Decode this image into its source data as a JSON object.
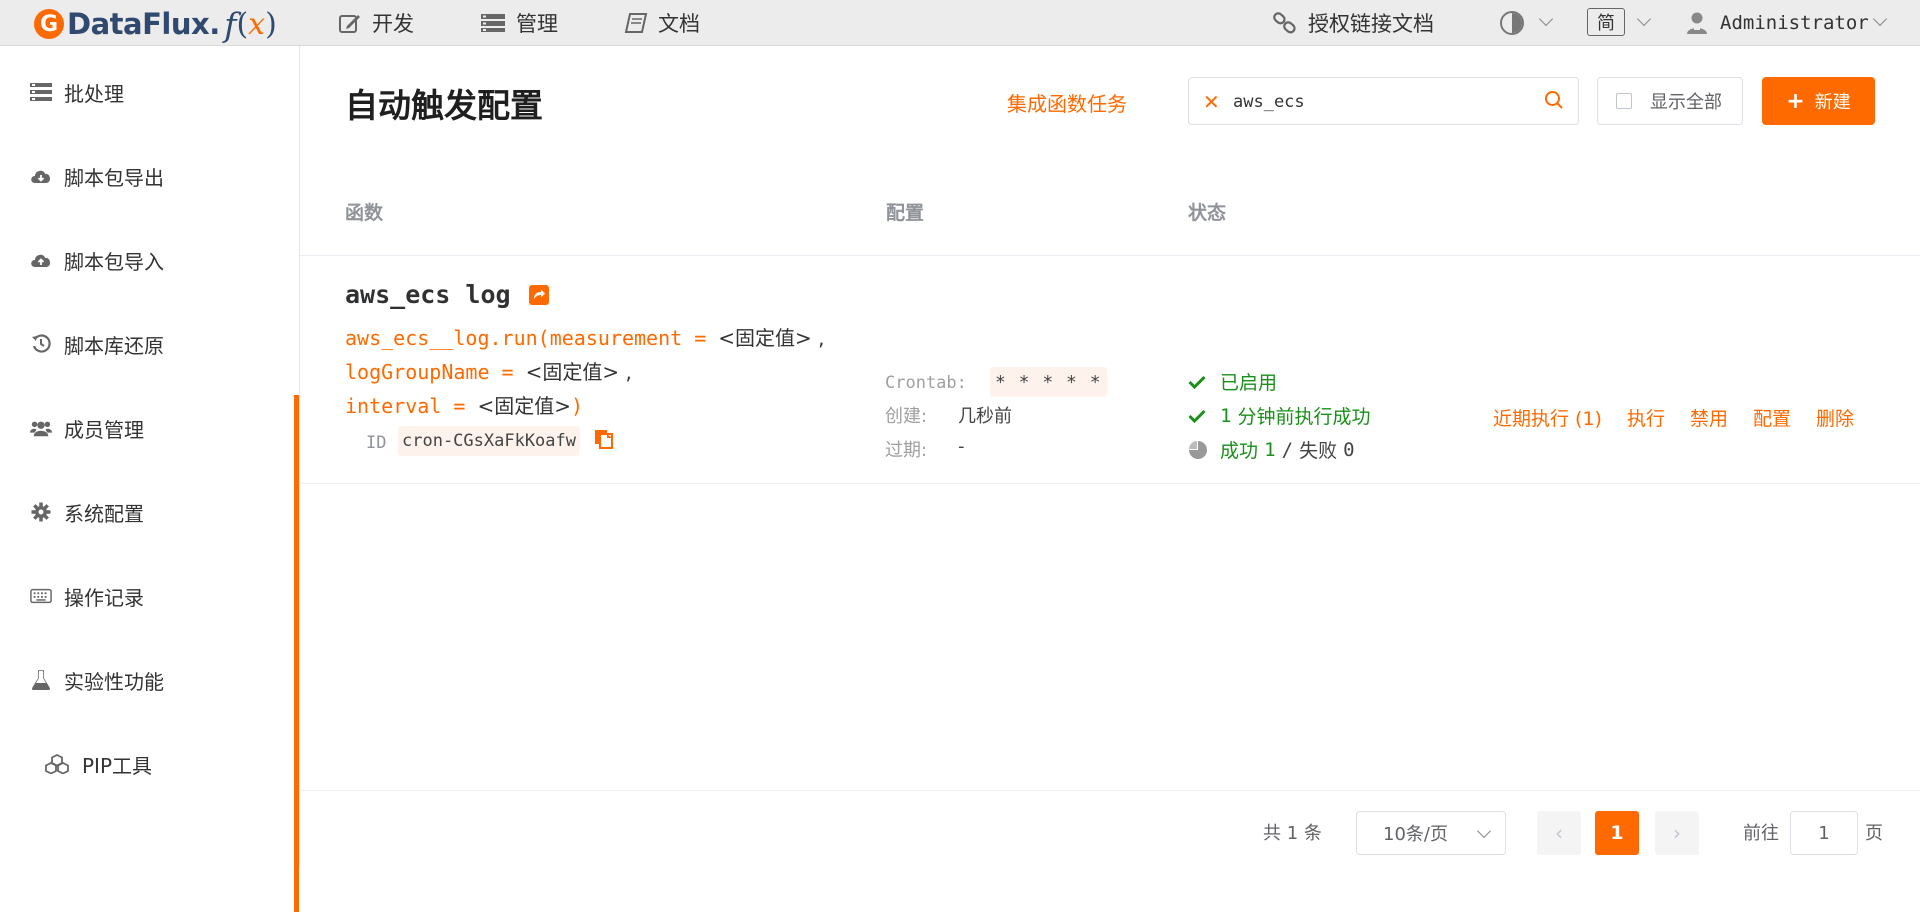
{
  "brand": {
    "name": "DataFlux",
    "dot": ".",
    "f": "f",
    "paren_open": "(",
    "x": "x",
    "paren_close": ")"
  },
  "topnav": {
    "dev": "开发",
    "manage": "管理",
    "docs": "文档",
    "auth_link_docs": "授权链接文档",
    "lang": "简",
    "user": "Administrator"
  },
  "sidebar": {
    "items": [
      {
        "label": "批处理",
        "icon": "batch-icon"
      },
      {
        "label": "脚本包导出",
        "icon": "cloud-download-icon"
      },
      {
        "label": "脚本包导入",
        "icon": "cloud-upload-icon"
      },
      {
        "label": "脚本库还原",
        "icon": "history-icon"
      },
      {
        "label": "成员管理",
        "icon": "users-icon"
      },
      {
        "label": "系统配置",
        "icon": "gear-icon"
      },
      {
        "label": "操作记录",
        "icon": "keyboard-icon"
      },
      {
        "label": "实验性功能",
        "icon": "flask-icon"
      },
      {
        "label": "PIP工具",
        "icon": "cubes-icon"
      }
    ]
  },
  "page": {
    "title": "自动触发配置",
    "integration_link": "集成函数任务",
    "search_value": "aws_ecs",
    "show_all": "显示全部",
    "new_button": "新建"
  },
  "table": {
    "headers": {
      "func": "函数",
      "config": "配置",
      "status": "状态"
    },
    "row": {
      "title": "aws_ecs log",
      "code_line1_a": "aws_ecs__log.run(measurement = ",
      "code_line1_b": "<固定值>",
      "code_line1_c": " ,",
      "code_line2_a": "logGroupName = ",
      "code_line2_b": "<固定值>",
      "code_line2_c": " ,",
      "code_line3_a": "interval = ",
      "code_line3_b": "<固定值>",
      "code_line3_c": ")",
      "id_label": "ID",
      "id_value": "cron-CGsXaFkKoafw",
      "crontab_label": "Crontab:",
      "crontab_value": "* * * * *",
      "created_label": "创建:",
      "created_value": "几秒前",
      "expire_label": "过期:",
      "expire_value": "-",
      "status_enabled": "已启用",
      "last_run_num": "1",
      "last_run_text": "分钟前执行成功",
      "stat_success_label": "成功",
      "stat_success": "1",
      "stat_sep": "/",
      "stat_fail_label": "失败",
      "stat_fail": "0",
      "actions": [
        "近期执行 (1)",
        "执行",
        "禁用",
        "配置",
        "删除"
      ]
    }
  },
  "pagination": {
    "total": "共 1 条",
    "page_size": "10条/页",
    "current": "1",
    "goto_prefix": "前往",
    "goto_value": "1",
    "goto_suffix": "页"
  },
  "colors": {
    "accent": "#ff6a00",
    "success": "#1a8f1a",
    "brand_text": "#2f4a6e"
  }
}
